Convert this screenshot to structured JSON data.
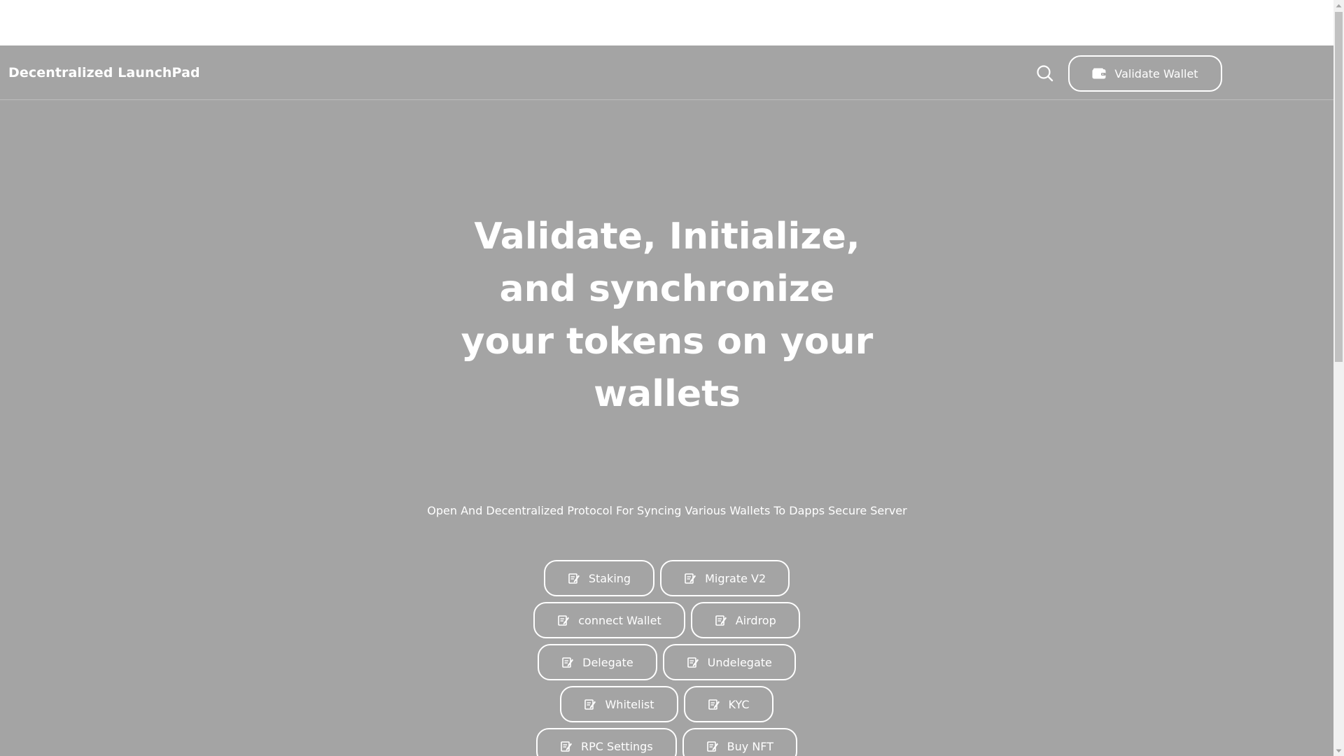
{
  "navbar": {
    "brand": "Decentralized LaunchPad",
    "search_icon": "search-icon",
    "validate_button": {
      "label": "Validate Wallet",
      "icon": "wallet-icon"
    }
  },
  "hero": {
    "title": "Validate, Initialize, and synchronize your tokens on your wallets",
    "subtitle": "Open And Decentralized Protocol For Syncing Various Wallets To Dapps Secure Server"
  },
  "buttons": [
    [
      "Staking",
      "Migrate V2"
    ],
    [
      "connect Wallet",
      "Airdrop"
    ],
    [
      "Delegate",
      "Undelegate"
    ],
    [
      "Whitelist",
      "KYC"
    ],
    [
      "RPC Settings",
      "Buy NFT"
    ]
  ],
  "button_icon": "note-pencil-icon",
  "colors": {
    "page_background": "#a4a4a4",
    "text": "#ffffff",
    "top_strip": "#ffffff"
  }
}
